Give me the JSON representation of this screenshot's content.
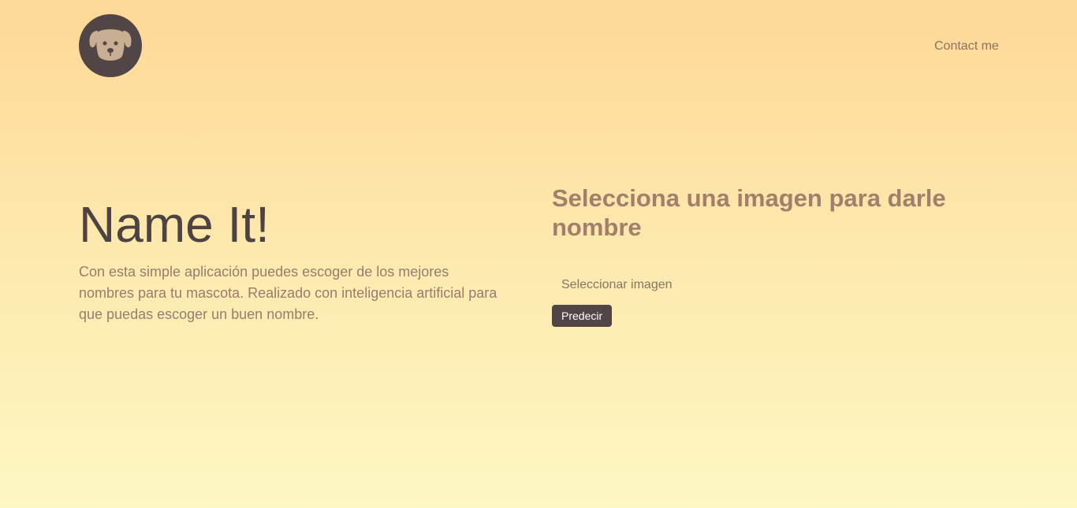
{
  "header": {
    "logo_icon": "dog-face-icon",
    "nav_contact": "Contact me"
  },
  "hero": {
    "title": "Name It!",
    "description": "Con esta simple aplicación puedes escoger de los mejores nombres para tu mascota. Realizado con inteligencia artificial para que puedas escoger un buen nombre."
  },
  "upload": {
    "title": "Selecciona una imagen para darle nombre",
    "file_label": "Seleccionar imagen",
    "submit_label": "Predecir"
  },
  "colors": {
    "background_top": "#fed896",
    "background_bottom": "#fdf7c2",
    "dark": "#524545",
    "accent_text": "#a27e6b"
  }
}
